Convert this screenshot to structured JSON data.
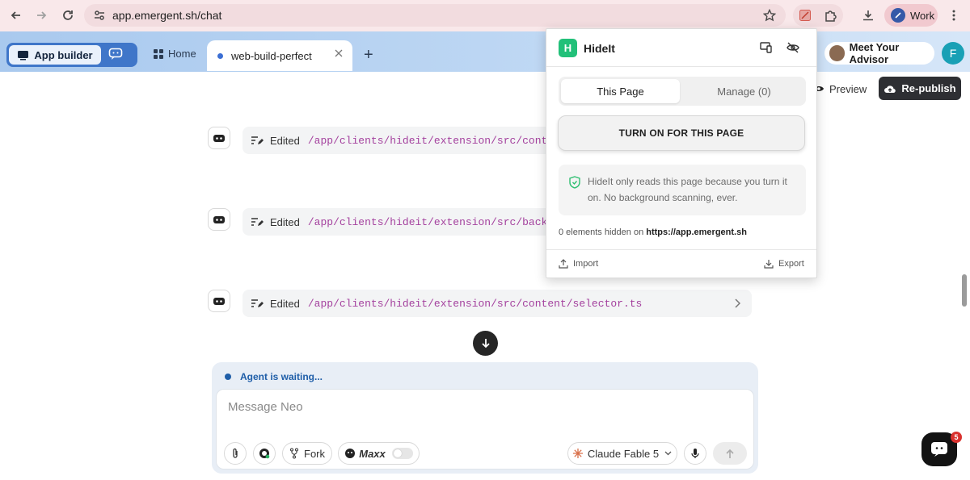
{
  "browser": {
    "url": "app.emergent.sh/chat",
    "profile_label": "Work"
  },
  "app": {
    "app_builder_label": "App builder",
    "home_label": "Home",
    "tab_title": "web-build-perfect",
    "advisor_label": "Meet Your Advisor",
    "avatar_initial": "F",
    "preview_label": "Preview",
    "republish_label": "Re-publish"
  },
  "chat": {
    "rows": [
      {
        "action": "Edited",
        "path": "/app/clients/hideit/extension/src/content"
      },
      {
        "action": "Edited",
        "path": "/app/clients/hideit/extension/src/backgro"
      },
      {
        "action": "Edited",
        "path": "/app/clients/hideit/extension/src/content/selector.ts"
      }
    ],
    "status": "Agent is waiting...",
    "placeholder": "Message Neo",
    "fork_label": "Fork",
    "maxx_label": "Maxx",
    "model_label": "Claude Fable 5",
    "notification_count": "5"
  },
  "popup": {
    "logo_letter": "H",
    "title": "HideIt",
    "tabs": [
      "This Page",
      "Manage (0)"
    ],
    "turn_on_label": "TURN ON FOR THIS PAGE",
    "info_text": "HideIt only reads this page because you turn it on. No background scanning, ever.",
    "hidden_count_text": "0 elements hidden on",
    "hidden_site": "https://app.emergent.sh",
    "import_label": "Import",
    "export_label": "Export"
  },
  "colors": {
    "accent_blue": "#3f76c9",
    "popup_logo": "#22c079",
    "path_text": "#a4419e",
    "badge": "#d9322f"
  }
}
